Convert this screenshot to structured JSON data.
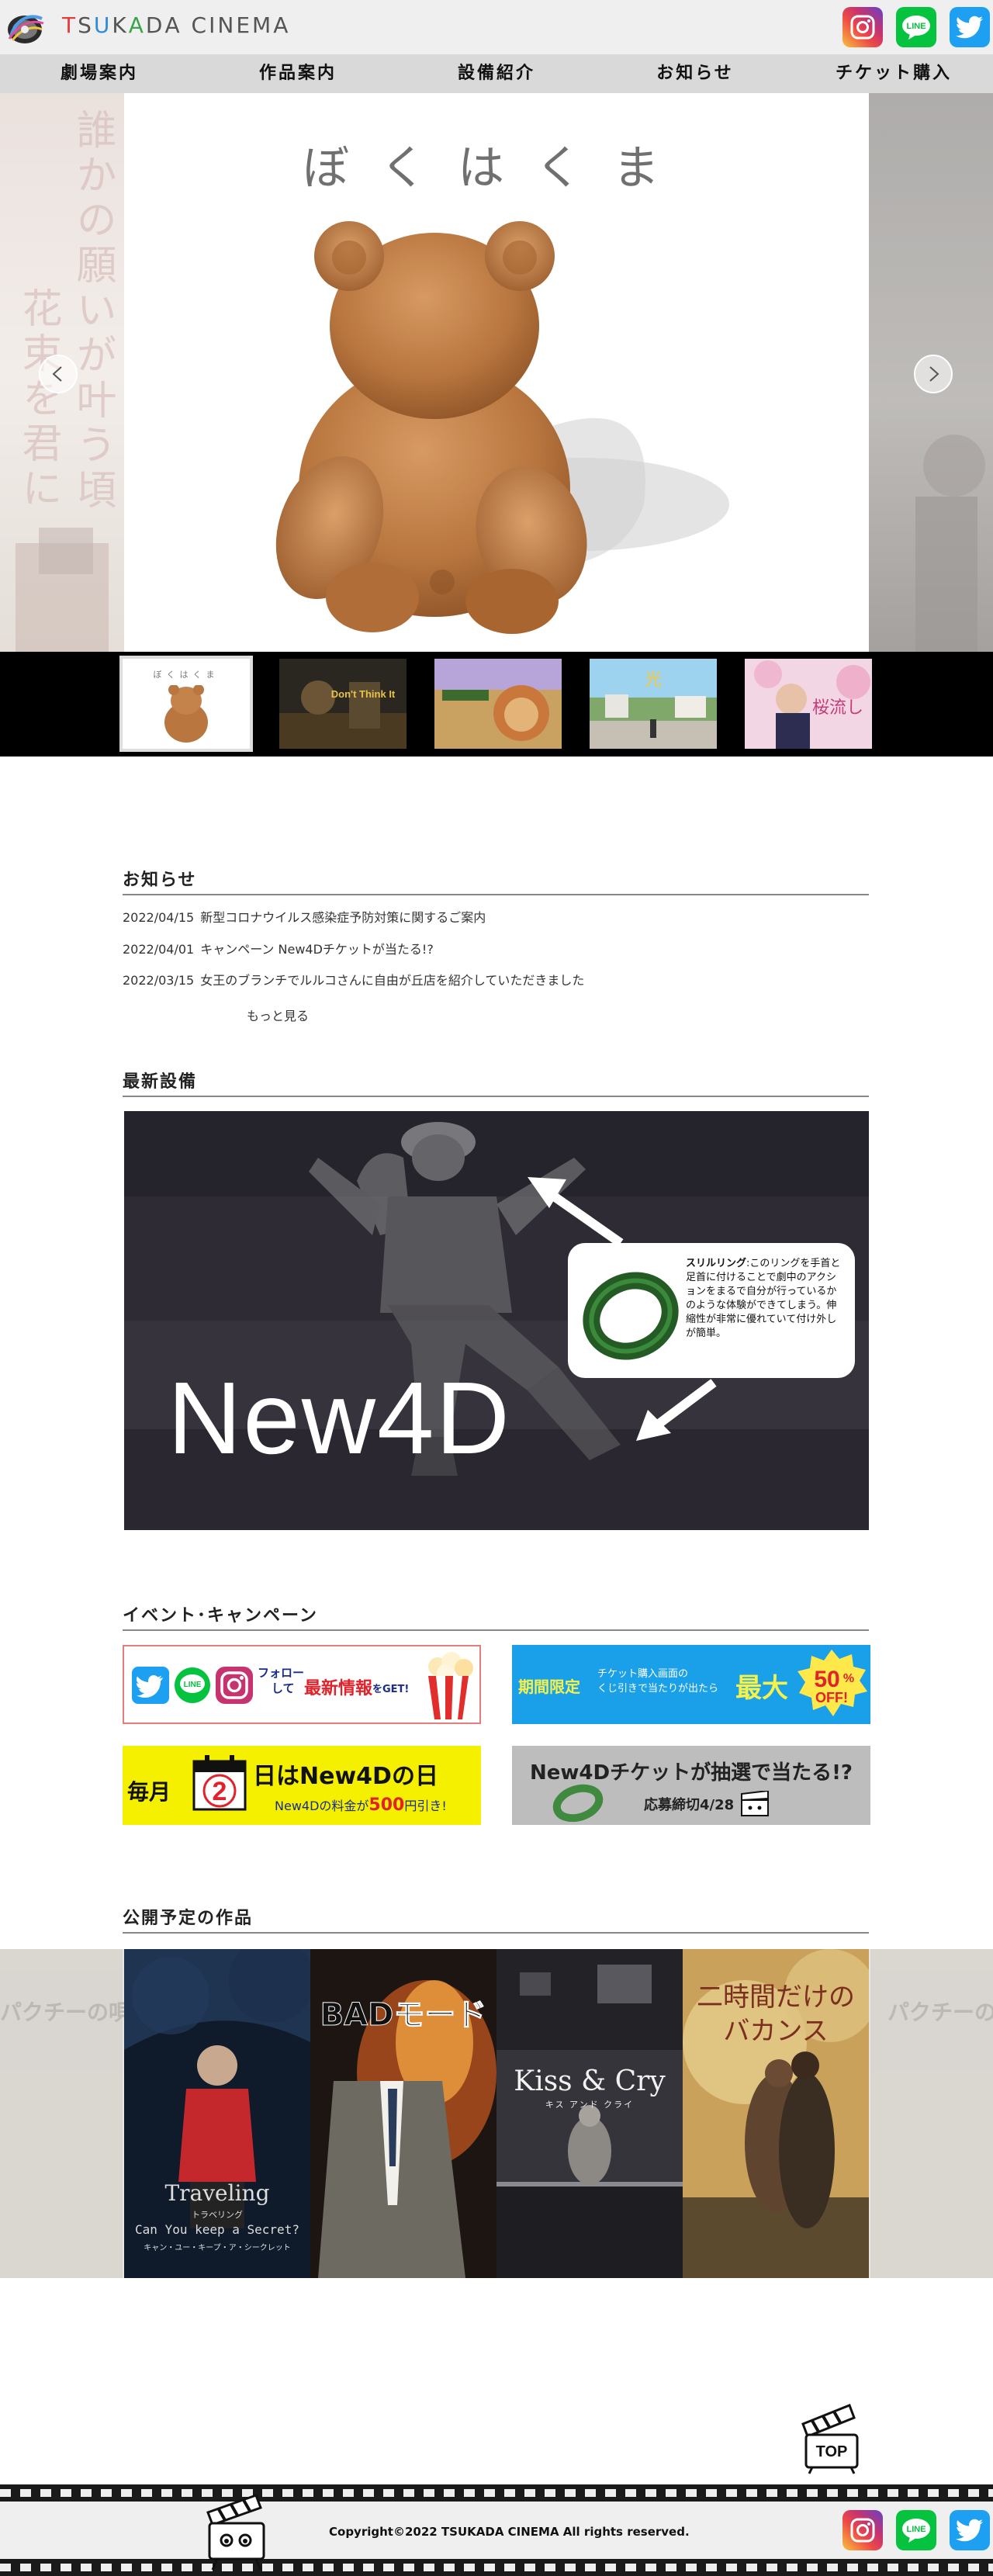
{
  "header": {
    "brand": "TSUKADA CINEMA",
    "brand_letter_colors": [
      "#e23d3d",
      "#555555",
      "#2e8bd8",
      "#555555",
      "#3aa44a",
      "#555555",
      "#555555",
      "#555555",
      "#555555",
      "#555555",
      "#555555",
      "#555555",
      "#555555",
      "#555555"
    ],
    "social": [
      {
        "icon": "instagram-icon"
      },
      {
        "icon": "line-icon",
        "label": "LINE"
      },
      {
        "icon": "twitter-icon"
      }
    ]
  },
  "nav": [
    "劇場案内",
    "作品案内",
    "設備紹介",
    "お知らせ",
    "チケット購入"
  ],
  "hero": {
    "title": "ぼくはくま",
    "left_peek_text": "誰かの願いが叶う頃 花束を君に"
  },
  "thumbs": [
    {
      "label": "ぼくはくま"
    },
    {
      "label": "Don't Think It"
    },
    {
      "label": ""
    },
    {
      "label": "光"
    },
    {
      "label": "桜流し"
    }
  ],
  "news": {
    "heading": "お知らせ",
    "items": [
      {
        "date": "2022/04/15",
        "text": "新型コロナウイルス感染症予防対策に関するご案内"
      },
      {
        "date": "2022/04/01",
        "text": "キャンペーン New4Dチケットが当たる!?"
      },
      {
        "date": "2022/03/15",
        "text": "女王のブランチでルルコさんに自由が丘店を紹介していただきました"
      }
    ],
    "more": "もっと見る"
  },
  "facility": {
    "heading": "最新設備",
    "name": "New4D",
    "bubble_title": "スリルリング",
    "bubble_text": ":このリングを手首と足首に付けることで劇中のアクションをまるで自分が行っているかのような体験ができてしまう。伸縮性が非常に優れていて付け外しが簡単。"
  },
  "events": {
    "heading": "イベント･キャンペーン",
    "banner1": {
      "line1": "フォロー",
      "line2": "して",
      "highlight": "最新情報",
      "tail": "をGET!"
    },
    "banner2": {
      "tag": "期間限定",
      "text1": "チケット購入画面の",
      "text2": "くじ引きで当たりが出たら",
      "big": "最大",
      "badge_num": "50",
      "badge_pct": "%",
      "badge_off": "OFF!"
    },
    "banner3": {
      "prefix": "毎月",
      "day": "2",
      "suffix": "日はNew4Dの日",
      "sub_a": "New4Dの料金が",
      "sub_price": "500",
      "sub_b": "円引き!"
    },
    "banner4": {
      "title": "New4Dチケットが抽選で当たる!?",
      "sub": "応募締切4/28"
    }
  },
  "upcoming": {
    "heading": "公開予定の作品",
    "posters": [
      {
        "title": "Traveling",
        "kana": "トラベリング",
        "sub": "Can You keep a Secret?",
        "sub_kana": "キャン・ユー・キープ・ア・シークレット"
      },
      {
        "title": "BADモード"
      },
      {
        "title": "Kiss & Cry",
        "kana": "キス アンド クライ"
      },
      {
        "title": "二時間だけのバカンス"
      }
    ],
    "peek_text": "パクチーの唄"
  },
  "footer": {
    "top_label": "TOP",
    "copyright": "Copyright©2022 TSUKADA CINEMA All rights reserved."
  },
  "colors": {
    "nav_bg": "#d9d9d9",
    "header_bg": "#efefef",
    "twitter": "#1da0f2",
    "line": "#05c33f",
    "banner_blue": "#1aa0e8",
    "banner_yellow": "#f4f000"
  }
}
